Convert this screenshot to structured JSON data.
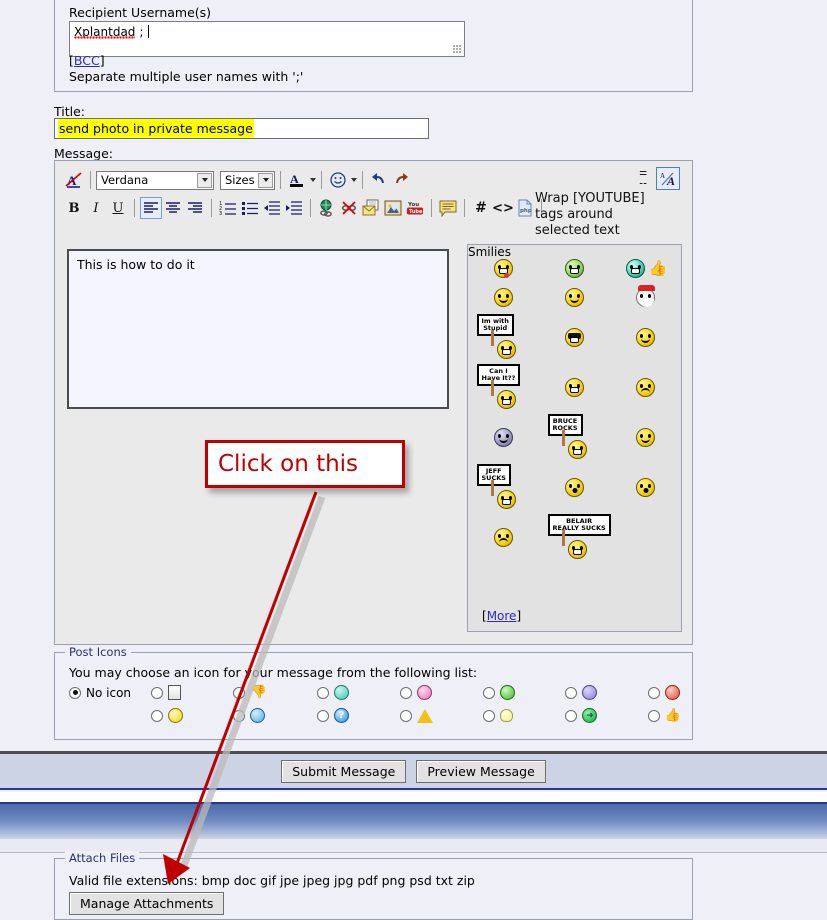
{
  "recipient": {
    "legend": "",
    "label": "Recipient Username(s)",
    "value": "Xplantdad",
    "separator": " ; ",
    "bcc_label": "[",
    "bcc_link": "BCC",
    "bcc_label_end": "]",
    "hint": "Separate multiple user names with ';'"
  },
  "title": {
    "label": "Title:",
    "value": "send photo in private message",
    "highlight_color": "#ffff00"
  },
  "message": {
    "label": "Message:",
    "body": "This is how to do it"
  },
  "toolbar": {
    "font_family": "Verdana",
    "font_size": "Sizes",
    "remove_format_icon": "remove-formatting-icon",
    "font_color_icon": "font-color-icon",
    "smilie_icon": "smilie-insert-icon",
    "undo_icon": "undo-icon",
    "redo_icon": "redo-icon",
    "bold": "B",
    "italic": "I",
    "underline": "U",
    "align_left_icon": "align-left-icon",
    "align_center_icon": "align-center-icon",
    "align_right_icon": "align-right-icon",
    "ordered_list_icon": "ordered-list-icon",
    "unordered_list_icon": "unordered-list-icon",
    "outdent_icon": "outdent-icon",
    "indent_icon": "indent-icon",
    "link_icon": "insert-link-icon",
    "unlink_icon": "remove-link-icon",
    "email_icon": "insert-email-icon",
    "image_icon": "insert-image-icon",
    "youtube_icon": "insert-youtube-icon",
    "quote_icon": "insert-quote-icon",
    "hash": "#",
    "code": "<>",
    "php_icon": "insert-php-icon",
    "tooltip": "Wrap [YOUTUBE] tags around selected text",
    "expand_icon": "expand-collapse-icon",
    "wysiwyg_toggle_icon": "wysiwyg-toggle-icon"
  },
  "smilies": {
    "legend": "Smilies",
    "more_open": "[",
    "more_label": "More",
    "more_close": "]",
    "rows": [
      [
        {
          "name": "tongue-smilie",
          "kind": "tongue",
          "color": "yellow"
        },
        {
          "name": "green-smilie",
          "kind": "grin",
          "color": "green"
        },
        {
          "name": "teal-thumbs-up-smilie",
          "kind": "thumb",
          "color": "teal"
        }
      ],
      [
        {
          "name": "plain-smilie",
          "kind": "plain",
          "color": "yellow"
        },
        {
          "name": "halo-smilie",
          "kind": "halo",
          "color": "yellow"
        },
        {
          "name": "santa-smilie",
          "kind": "santa",
          "color": "white"
        }
      ],
      [
        {
          "name": "im-with-stupid-sign-smilie",
          "kind": "sign",
          "sign": "Im with\nStupid",
          "color": "yellow"
        },
        {
          "name": "cool-sunglasses-smilie",
          "kind": "shades",
          "color": "yellow"
        },
        {
          "name": "bow-down-smilie",
          "kind": "bow",
          "color": "yellow"
        }
      ],
      [
        {
          "name": "can-i-have-it-sign-smilie",
          "kind": "sign",
          "sign": "Can I\nHave It??",
          "color": "yellow"
        },
        {
          "name": "big-grin-smilie",
          "kind": "grin",
          "color": "yellow"
        },
        {
          "name": "confused-smilie",
          "kind": "confused",
          "color": "yellow"
        }
      ],
      [
        {
          "name": "purple-alien-smilie",
          "kind": "alien",
          "color": "grayp"
        },
        {
          "name": "bruce-rocks-sign-smilie",
          "kind": "sign",
          "sign": "BRUCE\nROCKS",
          "color": "yellow"
        },
        {
          "name": "hammered-smilie",
          "kind": "hammer",
          "color": "yellow"
        }
      ],
      [
        {
          "name": "jeff-sucks-sign-smilie",
          "kind": "sign",
          "sign": "JEFF\nSUCKS",
          "color": "yellow"
        },
        {
          "name": "shocked-smilie",
          "kind": "shocked",
          "color": "yellow"
        },
        {
          "name": "drink-smilie",
          "kind": "drink",
          "color": "yellow"
        }
      ],
      [
        {
          "name": "sad-smilie",
          "kind": "sad",
          "color": "yellow"
        },
        {
          "name": "belair-really-sucks-sign-smilie",
          "kind": "sign",
          "sign": "BELAIR\nREALLY SUCKS",
          "color": "yellow"
        },
        {
          "name": "empty-cell",
          "kind": "empty",
          "color": "none"
        }
      ]
    ]
  },
  "post_icons": {
    "legend": "Post Icons",
    "instruction": "You may choose an icon for your message from the following list:",
    "no_icon_label": "No icon",
    "columns": [
      [
        {
          "name": "icon-document",
          "glyph": "doc",
          "selected": false
        },
        {
          "name": "icon-smile",
          "glyph": "smile",
          "selected": false
        }
      ],
      [
        {
          "name": "icon-thumbs-down",
          "glyph": "thumbdn",
          "selected": false
        },
        {
          "name": "icon-cool",
          "glyph": "cool",
          "selected": false
        }
      ],
      [
        {
          "name": "icon-wink",
          "glyph": "wink",
          "selected": false
        },
        {
          "name": "icon-question",
          "glyph": "question",
          "selected": false
        }
      ],
      [
        {
          "name": "icon-pink-embarrassed",
          "glyph": "pink",
          "selected": false
        },
        {
          "name": "icon-exclamation",
          "glyph": "warn",
          "selected": false
        }
      ],
      [
        {
          "name": "icon-green-grin",
          "glyph": "greengrin",
          "selected": false
        },
        {
          "name": "icon-lightbulb",
          "glyph": "bulb",
          "selected": false
        }
      ],
      [
        {
          "name": "icon-purple-frown",
          "glyph": "purple",
          "selected": false
        },
        {
          "name": "icon-arrow",
          "glyph": "arrow",
          "selected": false
        }
      ],
      [
        {
          "name": "icon-red-angry",
          "glyph": "red",
          "selected": false
        },
        {
          "name": "icon-thumbs-up",
          "glyph": "thumbup",
          "selected": false
        }
      ]
    ]
  },
  "buttons": {
    "submit": "Submit Message",
    "preview": "Preview Message"
  },
  "attach": {
    "legend": "Attach Files",
    "extensions_text": "Valid file extensions: bmp doc gif jpe jpeg jpg pdf png psd txt zip",
    "manage_label": "Manage Attachments"
  },
  "annotation": {
    "callout_text": "Click on this",
    "color": "#c00000"
  }
}
